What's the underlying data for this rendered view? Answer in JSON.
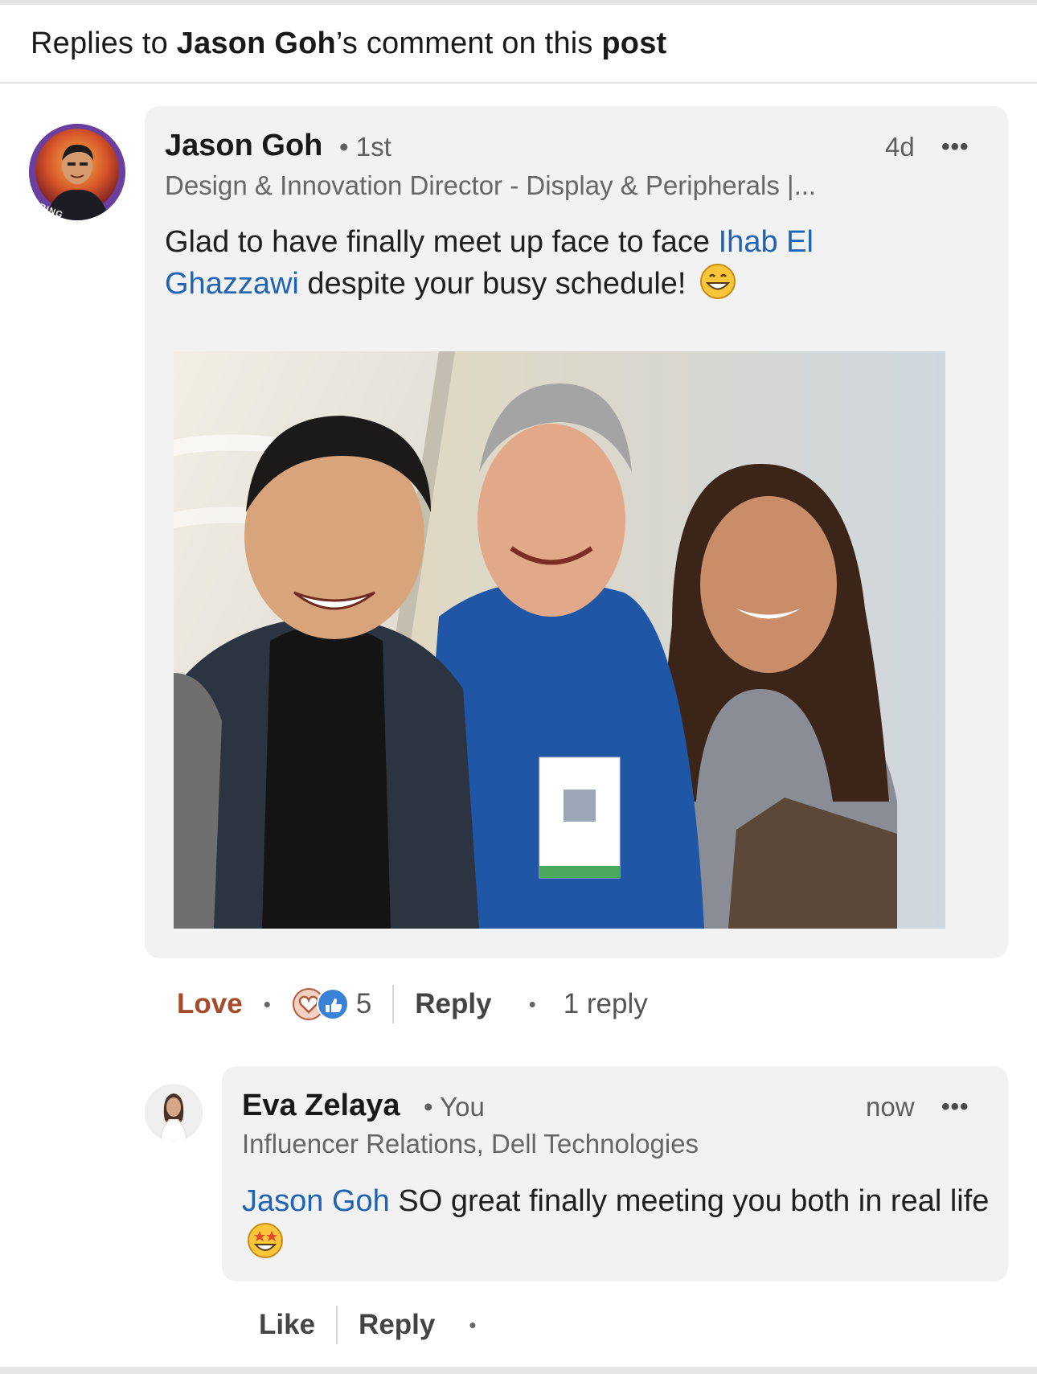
{
  "header": {
    "prefix": "Replies to ",
    "author": "Jason Goh",
    "middle": "’s comment on this ",
    "post_word": "post"
  },
  "comment": {
    "author": "Jason Goh",
    "degree": "• 1st",
    "headline": "Design & Innovation Director - Display & Peripherals |...",
    "time": "4d",
    "more": "•••",
    "text_before": "Glad to have finally meet up face to face ",
    "mention": "Ihab El Ghazzawi",
    "text_after": " despite your busy schedule!",
    "emoji": "grinning-face-icon",
    "avatar_badge": "#HIRING",
    "photo_alt": "Selfie of three people at Dell Technologies World"
  },
  "comment_actions": {
    "love": "Love",
    "reaction_count": "5",
    "reply": "Reply",
    "reply_count": "1 reply",
    "dot": "•"
  },
  "reply": {
    "author": "Eva Zelaya",
    "degree": "• You",
    "headline": "Influencer Relations, Dell Technologies",
    "time": "now",
    "more": "•••",
    "mention": "Jason Goh",
    "text_after": " SO great finally meeting you both in real life",
    "emoji": "star-struck-icon"
  },
  "reply_actions": {
    "like": "Like",
    "reply": "Reply",
    "dot": "•"
  },
  "colors": {
    "mention": "#1f64b4",
    "love": "#a54a2a",
    "bubble": "#f2f2f2"
  }
}
